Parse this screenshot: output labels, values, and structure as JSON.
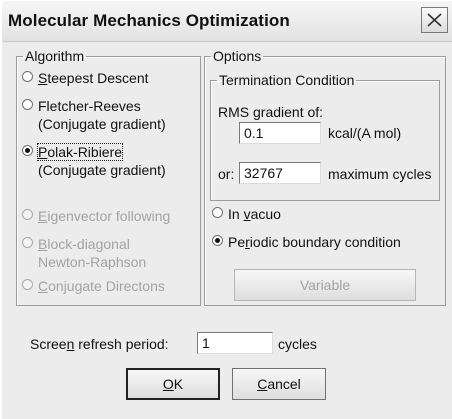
{
  "window": {
    "title": "Molecular Mechanics Optimization",
    "close_icon": "close-icon"
  },
  "algorithm": {
    "legend": "Algorithm",
    "options": [
      {
        "mnemonic": "S",
        "rest": "teepest Descent",
        "line2": "",
        "checked": false,
        "enabled": true
      },
      {
        "mnemonic": "",
        "rest": "Fletcher-Reeves",
        "line2": "(Conjugate gradient)",
        "checked": false,
        "enabled": true
      },
      {
        "mnemonic": "P",
        "rest": "olak-Ribiere",
        "line2": "(Conjugate gradient)",
        "checked": true,
        "enabled": true
      },
      {
        "mnemonic": "E",
        "rest": "igenvector following",
        "line2": "",
        "checked": false,
        "enabled": false
      },
      {
        "mnemonic": "B",
        "rest": "lock-diagonal",
        "line2": "Newton-Raphson",
        "checked": false,
        "enabled": false
      },
      {
        "mnemonic": "C",
        "rest": "onjugate Directons",
        "line2": "",
        "checked": false,
        "enabled": false
      }
    ]
  },
  "options": {
    "legend": "Options",
    "termination": {
      "legend": "Termination Condition",
      "rms_label": "RMS gradient of:",
      "rms_value": "0.1",
      "rms_unit": "kcal/(A mol)",
      "or_label": "or:",
      "cycles_value": "32767",
      "cycles_unit": "maximum cycles"
    },
    "in_vacuo": {
      "pre": "In ",
      "mnemonic": "v",
      "post": "acuo",
      "checked": false
    },
    "periodic": {
      "pre": "Pe",
      "mnemonic": "r",
      "post": "iodic boundary condition",
      "checked": true
    },
    "variable_button": "Variable"
  },
  "refresh": {
    "label_pre": "Scree",
    "label_mnemonic": "n",
    "label_post": " refresh period:",
    "value": "1",
    "unit": "cycles"
  },
  "buttons": {
    "ok_mnemonic": "O",
    "ok_rest": "K",
    "cancel_mnemonic": "C",
    "cancel_rest": "ancel"
  }
}
